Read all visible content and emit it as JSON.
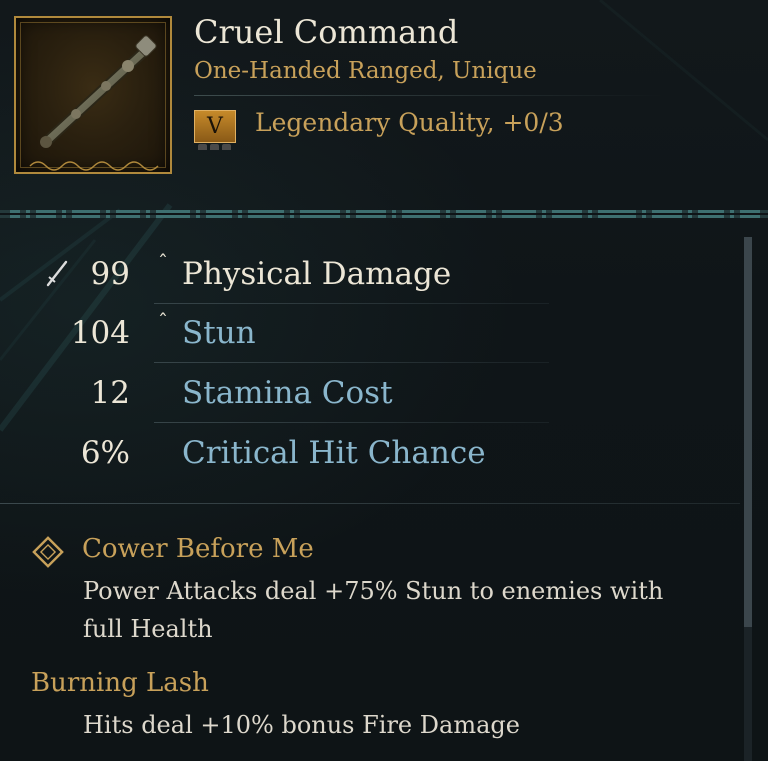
{
  "item": {
    "name": "Cruel Command",
    "type_line": "One-Handed Ranged, Unique",
    "quality_badge": "V",
    "quality_text": "Legendary Quality, +0/3"
  },
  "stats": [
    {
      "value": "99",
      "improved": true,
      "label": "Physical Damage",
      "highlight": true
    },
    {
      "value": "104",
      "improved": true,
      "label": "Stun",
      "highlight": false
    },
    {
      "value": "12",
      "improved": false,
      "label": "Stamina Cost",
      "highlight": false
    },
    {
      "value": "6%",
      "improved": false,
      "label": "Critical Hit Chance",
      "highlight": false
    }
  ],
  "improved_marker": "ˆ",
  "perks": [
    {
      "title": "Cower Before Me",
      "desc_line1": "Power Attacks deal +75% Stun to enemies with",
      "desc_line2": "full Health"
    },
    {
      "title": "Burning Lash",
      "desc_line1": "Hits deal +10% bonus Fire Damage"
    }
  ],
  "icons": {
    "item_image": "scepter-icon",
    "stat_primary": "sword-icon",
    "perk": "diamond-icon"
  },
  "colors": {
    "gold": "#c8a15a",
    "stat_label_blue": "#8ab6cc",
    "text_white": "#ece6d6",
    "frame_gold": "#b0893c",
    "accent_teal": "#2e6b6b"
  }
}
